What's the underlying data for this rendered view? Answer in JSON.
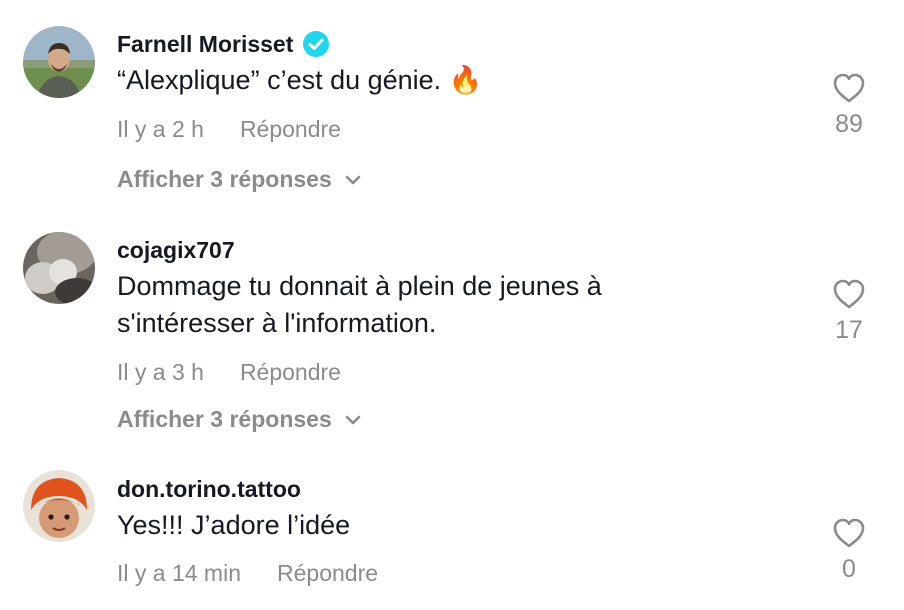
{
  "comments": [
    {
      "username": "Farnell Morisset",
      "verified": true,
      "text_lines": [
        "“Alexplique” c’est du génie. 🔥"
      ],
      "time": "Il y a 2 h",
      "reply_label": "Répondre",
      "replies_label": "Afficher 3 réponses",
      "likes": "89"
    },
    {
      "username": "cojagix707",
      "verified": false,
      "text_lines": [
        "Dommage tu donnait à plein de jeunes à",
        "s'intéresser à l'information."
      ],
      "time": "Il y a 3 h",
      "reply_label": "Répondre",
      "replies_label": "Afficher 3 réponses",
      "likes": "17"
    },
    {
      "username": "don.torino.tattoo",
      "verified": false,
      "text_lines": [
        "Yes!!! J’adore l’idée"
      ],
      "time": "Il y a 14 min",
      "reply_label": "Répondre",
      "likes": "0"
    }
  ],
  "colors": {
    "primary_text": "#161823",
    "secondary_text": "#8a8b91",
    "verified_badge": "#20d5ec"
  },
  "icons": {
    "like": "heart-outline-icon",
    "verified": "verified-check-icon",
    "expand": "chevron-down-icon"
  }
}
